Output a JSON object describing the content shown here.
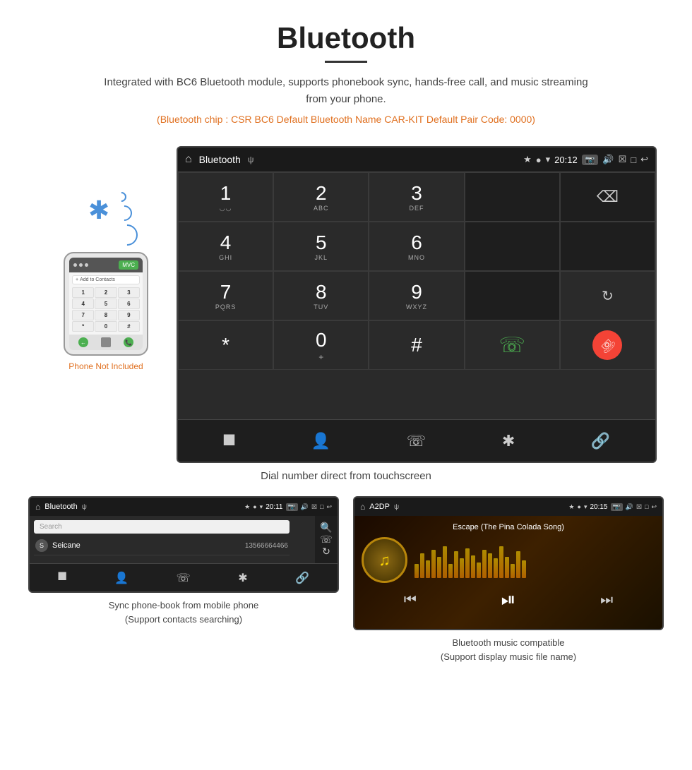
{
  "header": {
    "title": "Bluetooth",
    "description": "Integrated with BC6 Bluetooth module, supports phonebook sync, hands-free call, and music streaming from your phone.",
    "specs": "(Bluetooth chip : CSR BC6    Default Bluetooth Name CAR-KIT    Default Pair Code: 0000)"
  },
  "main_screen": {
    "statusbar": {
      "title": "Bluetooth",
      "usb": "ψ",
      "time": "20:12"
    },
    "dialpad": [
      {
        "num": "1",
        "sub": "◌◡"
      },
      {
        "num": "2",
        "sub": "ABC"
      },
      {
        "num": "3",
        "sub": "DEF"
      },
      {
        "num": "",
        "sub": ""
      },
      {
        "num": "⌫",
        "sub": ""
      },
      {
        "num": "4",
        "sub": "GHI"
      },
      {
        "num": "5",
        "sub": "JKL"
      },
      {
        "num": "6",
        "sub": "MNO"
      },
      {
        "num": "",
        "sub": ""
      },
      {
        "num": "",
        "sub": ""
      },
      {
        "num": "7",
        "sub": "PQRS"
      },
      {
        "num": "8",
        "sub": "TUV"
      },
      {
        "num": "9",
        "sub": "WXYZ"
      },
      {
        "num": "",
        "sub": ""
      },
      {
        "num": "↻",
        "sub": ""
      },
      {
        "num": "*",
        "sub": ""
      },
      {
        "num": "0",
        "sub": "+"
      },
      {
        "num": "#",
        "sub": ""
      },
      {
        "num": "📞",
        "sub": ""
      },
      {
        "num": "📞",
        "sub": "end"
      }
    ],
    "caption": "Dial number direct from touchscreen"
  },
  "phone_section": {
    "not_included": "Phone Not Included"
  },
  "phonebook_screen": {
    "statusbar_title": "Bluetooth",
    "time": "20:11",
    "search_placeholder": "Search",
    "contact_initial": "S",
    "contact_name": "Seicane",
    "contact_number": "13566664466",
    "caption_line1": "Sync phone-book from mobile phone",
    "caption_line2": "(Support contacts searching)"
  },
  "music_screen": {
    "statusbar_title": "A2DP",
    "time": "20:15",
    "song_title": "Escape (The Pina Colada Song)",
    "viz_heights": [
      20,
      35,
      25,
      40,
      30,
      45,
      20,
      38,
      28,
      42,
      32,
      22,
      40,
      35,
      28,
      45,
      30,
      20,
      38,
      25
    ],
    "caption_line1": "Bluetooth music compatible",
    "caption_line2": "(Support display music file name)"
  }
}
